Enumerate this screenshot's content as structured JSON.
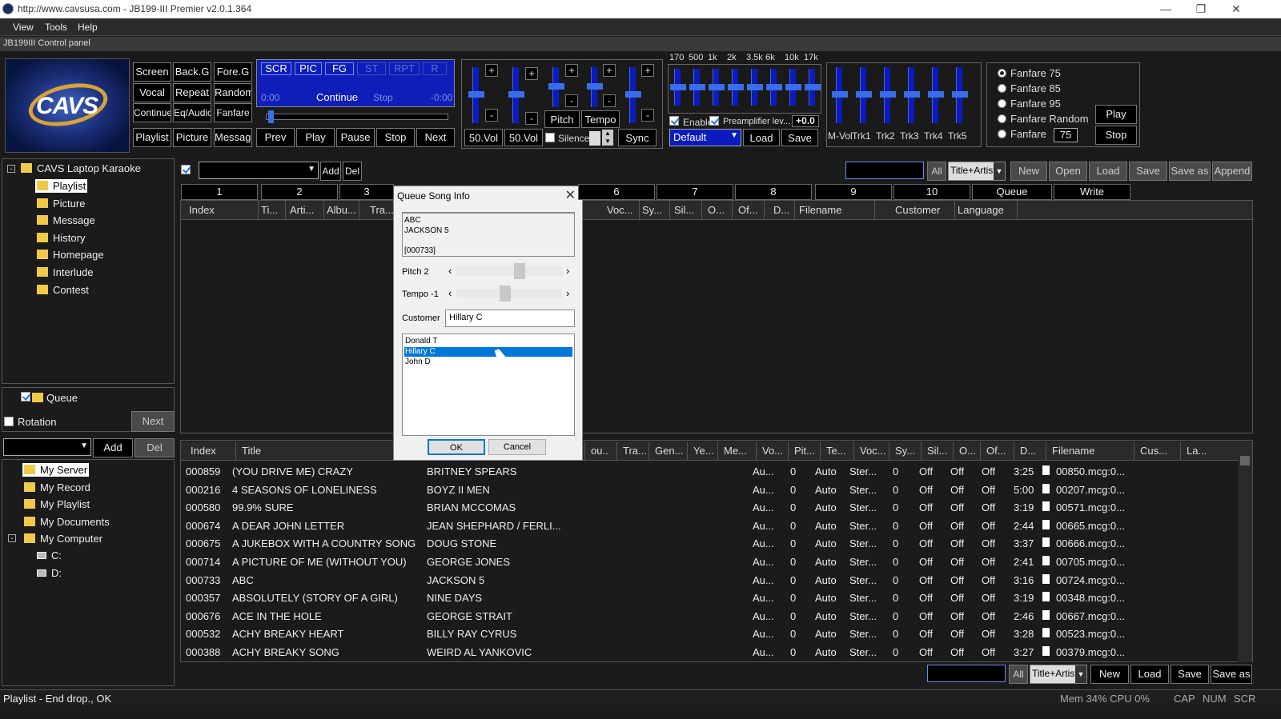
{
  "window": {
    "title": "http://www.cavsusa.com - JB199-III Premier v2.0.1.364"
  },
  "menu": {
    "view": "View",
    "tools": "Tools",
    "help": "Help"
  },
  "control_panel": {
    "title": "JB199III Control panel",
    "mode_buttons": [
      "Screen",
      "Back.G",
      "Fore.G",
      "Vocal",
      "Repeat",
      "Random",
      "Continue",
      "Eq/Audio",
      "Fanfare",
      "Playlist",
      "Picture",
      "Message"
    ],
    "display": {
      "toggles": [
        "SCR",
        "PIC",
        "FG",
        "ST",
        "RPT",
        "R"
      ],
      "time_left": "0:00",
      "status": "Continue",
      "status2": "Stop",
      "time_right": "-0:00"
    },
    "transport": [
      "Prev",
      "Play",
      "Pause",
      "Stop",
      "Next"
    ],
    "vol_labels": [
      "50.Vol",
      "50.Vol"
    ],
    "pitch_label": "Pitch",
    "tempo_label": "Tempo",
    "silence_label": "Silence",
    "sync_label": "Sync",
    "eq_freqs": [
      "170",
      "500",
      "1k",
      "2k",
      "3.5k",
      "6k",
      "10k",
      "17k"
    ],
    "eq_enable": "Enable",
    "eq_preamp": "Preamplifier lev...",
    "eq_preamp_val": "+0.0",
    "eq_preset": "Default",
    "eq_load": "Load",
    "eq_save": "Save",
    "track_labels": [
      "M-Vol",
      "Trk1",
      "Trk2",
      "Trk3",
      "Trk4",
      "Trk5"
    ],
    "fanfare": {
      "options": [
        "Fanfare 75",
        "Fanfare 85",
        "Fanfare 95",
        "Fanfare Random",
        "Fanfare"
      ],
      "value": "75",
      "play": "Play",
      "stop": "Stop"
    }
  },
  "left_tree": {
    "root": "CAVS Laptop Karaoke",
    "items": [
      "Playlist",
      "Picture",
      "Message",
      "History",
      "Homepage",
      "Interlude",
      "Contest"
    ]
  },
  "queue_panel": {
    "queue": "Queue",
    "rotation": "Rotation",
    "next": "Next",
    "add": "Add",
    "del": "Del"
  },
  "source_tree": {
    "items": [
      "My Server",
      "My Record",
      "My Playlist",
      "My Documents",
      "My Computer"
    ],
    "drives": [
      "C:",
      "D:"
    ]
  },
  "top_toolbar": {
    "add": "Add",
    "del": "Del",
    "all": "All",
    "search_mode": "Title+Artist",
    "new": "New",
    "open": "Open",
    "load": "Load",
    "save": "Save",
    "save_as": "Save as",
    "append": "Append"
  },
  "tabs": [
    "1",
    "2",
    "3",
    "6",
    "7",
    "8",
    "9",
    "10",
    "Queue",
    "Write"
  ],
  "top_headers": [
    "Index",
    "Ti...",
    "Arti...",
    "Albu...",
    "Tra...",
    "Voc...",
    "Sy...",
    "Sil...",
    "O...",
    "Of...",
    "D...",
    "Filename",
    "Customer",
    "Language"
  ],
  "bottom_headers": [
    "Index",
    "Title",
    "ou...",
    "Tra...",
    "Gen...",
    "Ye...",
    "Me...",
    "Vo...",
    "Pit...",
    "Te...",
    "Voc...",
    "Sy...",
    "Sil...",
    "O...",
    "Of...",
    "D...",
    "Filename",
    "Cus...",
    "La..."
  ],
  "songs": [
    [
      "000859",
      "(YOU DRIVE ME) CRAZY",
      "BRITNEY SPEARS",
      "Au...",
      "0",
      "Auto",
      "Ster...",
      "0",
      "Off",
      "Off",
      "Off",
      "3:25",
      "00850.mcg:0..."
    ],
    [
      "000216",
      "4 SEASONS OF LONELINESS",
      "BOYZ II MEN",
      "Au...",
      "0",
      "Auto",
      "Ster...",
      "0",
      "Off",
      "Off",
      "Off",
      "5:00",
      "00207.mcg:0..."
    ],
    [
      "000580",
      "99.9% SURE",
      "BRIAN MCCOMAS",
      "Au...",
      "0",
      "Auto",
      "Ster...",
      "0",
      "Off",
      "Off",
      "Off",
      "3:19",
      "00571.mcg:0..."
    ],
    [
      "000674",
      "A DEAR JOHN LETTER",
      "JEAN SHEPHARD / FERLI...",
      "Au...",
      "0",
      "Auto",
      "Ster...",
      "0",
      "Off",
      "Off",
      "Off",
      "2:44",
      "00665.mcg:0..."
    ],
    [
      "000675",
      "A JUKEBOX WITH A COUNTRY SONG",
      "DOUG STONE",
      "Au...",
      "0",
      "Auto",
      "Ster...",
      "0",
      "Off",
      "Off",
      "Off",
      "3:37",
      "00666.mcg:0..."
    ],
    [
      "000714",
      "A PICTURE OF ME (WITHOUT YOU)",
      "GEORGE JONES",
      "Au...",
      "0",
      "Auto",
      "Ster...",
      "0",
      "Off",
      "Off",
      "Off",
      "2:41",
      "00705.mcg:0..."
    ],
    [
      "000733",
      "ABC",
      "JACKSON 5",
      "Au...",
      "0",
      "Auto",
      "Ster...",
      "0",
      "Off",
      "Off",
      "Off",
      "3:16",
      "00724.mcg:0..."
    ],
    [
      "000357",
      "ABSOLUTELY (STORY OF A GIRL)",
      "NINE DAYS",
      "Au...",
      "0",
      "Auto",
      "Ster...",
      "0",
      "Off",
      "Off",
      "Off",
      "3:19",
      "00348.mcg:0..."
    ],
    [
      "000676",
      "ACE IN THE HOLE",
      "GEORGE STRAIT",
      "Au...",
      "0",
      "Auto",
      "Ster...",
      "0",
      "Off",
      "Off",
      "Off",
      "2:46",
      "00667.mcg:0..."
    ],
    [
      "000532",
      "ACHY BREAKY HEART",
      "BILLY RAY CYRUS",
      "Au...",
      "0",
      "Auto",
      "Ster...",
      "0",
      "Off",
      "Off",
      "Off",
      "3:28",
      "00523.mcg:0..."
    ],
    [
      "000388",
      "ACHY BREAKY SONG",
      "WEIRD AL YANKOVIC",
      "Au...",
      "0",
      "Auto",
      "Ster...",
      "0",
      "Off",
      "Off",
      "Off",
      "3:27",
      "00379.mcg:0..."
    ]
  ],
  "bottom_toolbar": {
    "all": "All",
    "search_mode": "Title+Artist",
    "new": "New",
    "load": "Load",
    "save": "Save",
    "save_as": "Save as"
  },
  "dialog": {
    "title": "Queue Song Info",
    "info_title": "ABC",
    "info_artist": "JACKSON 5",
    "info_index": "[000733]",
    "pitch_label": "Pitch 2",
    "tempo_label": "Tempo -1",
    "customer_label": "Customer",
    "customer_value": "Hillary C",
    "customers": [
      "Donald T",
      "Hillary C",
      "John D"
    ],
    "ok": "OK",
    "cancel": "Cancel"
  },
  "status": {
    "left": "Playlist - End drop., OK",
    "mem": "Mem 34% CPU  0%",
    "cap": "CAP",
    "num": "NUM",
    "scr": "SCR"
  },
  "icons": {
    "app": "cavs-app-icon",
    "close": "close-icon",
    "cursor": "mouse-cursor-icon"
  }
}
